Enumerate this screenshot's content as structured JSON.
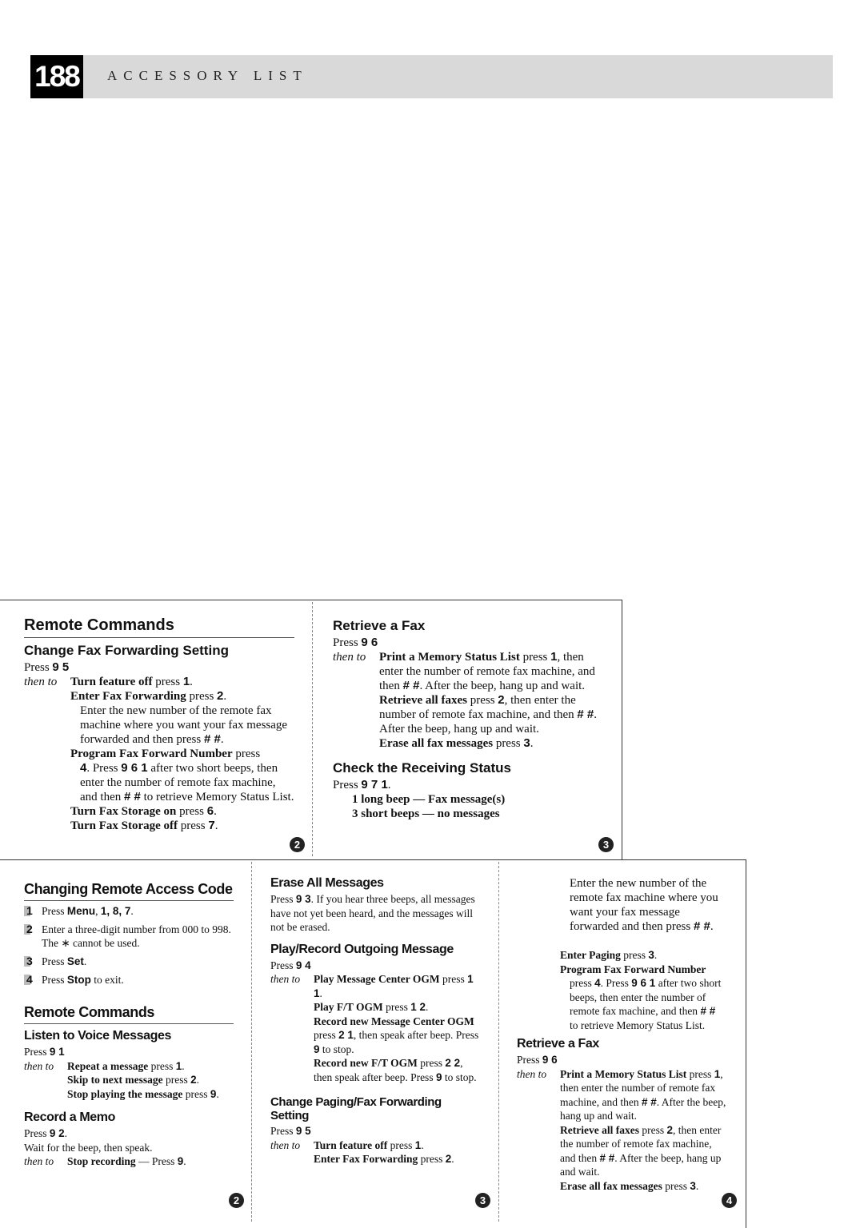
{
  "header": {
    "page_number": "188",
    "title": "ACCESSORY LIST"
  },
  "top_card": {
    "col1": {
      "title": "Remote Commands",
      "section": "Change Fax Forwarding Setting",
      "press_prefix": "Press",
      "press_keys": "9 5",
      "then_to": "then to",
      "items": [
        {
          "bold": "Turn feature off",
          "text": " press ",
          "key": "1",
          "end": "."
        },
        {
          "bold": "Enter Fax Forwarding",
          "text": " press ",
          "key": "2",
          "end": "."
        }
      ],
      "enter_note": {
        "text": "Enter the new number of the remote fax machine where you want your fax message forwarded and then press ",
        "key": "# #",
        "end": "."
      },
      "program": {
        "bold": "Program Fax Forward Number",
        "text": " press",
        "key1": "4",
        "mid1": ". Press ",
        "key2": "9 6 1",
        "mid2": " after two short beeps, then enter the number of remote fax machine, and then ",
        "key3": "# #",
        "end": " to retrieve Memory Status List."
      },
      "storage_on": {
        "bold": "Turn Fax Storage on",
        "text": " press ",
        "key": "6",
        "end": "."
      },
      "storage_off": {
        "bold": "Turn Fax Storage off",
        "text": " press ",
        "key": "7",
        "end": "."
      },
      "badge": "2"
    },
    "col2": {
      "section1": "Retrieve a Fax",
      "press_prefix": "Press",
      "press_keys": "9 6",
      "then_to": "then to",
      "print": {
        "bold": "Print a Memory Status List",
        "text": " press ",
        "key1": "1",
        "mid": ", then enter the number of remote fax machine, and then ",
        "key2": "# #",
        "end": ". After the beep, hang up and wait."
      },
      "retrieve_all": {
        "bold": "Retrieve all faxes",
        "text": " press ",
        "key1": "2",
        "mid": ", then enter the number of remote fax machine, and then ",
        "key2": "# #",
        "end": ". After the beep, hang up and wait."
      },
      "erase": {
        "bold": "Erase all fax messages",
        "text": " press ",
        "key": "3",
        "end": "."
      },
      "section2": "Check the Receiving Status",
      "press2_prefix": "Press",
      "press2_keys": "9 7 1",
      "press2_end": ".",
      "beep1": "1 long beep — Fax message(s)",
      "beep2": "3 short beeps — no messages",
      "badge": "3"
    }
  },
  "bottom_card": {
    "col1": {
      "title": "Changing Remote Access Code",
      "steps": [
        {
          "num": "1",
          "pre": "Press ",
          "key": "Menu",
          "post": ", ",
          "keys2": "1, 8, 7",
          "end": "."
        },
        {
          "num": "2",
          "text": "Enter a three-digit number from 000 to 998. The ∗ cannot be used."
        },
        {
          "num": "3",
          "pre": "Press ",
          "key": "Set",
          "end": "."
        },
        {
          "num": "4",
          "pre": "Press ",
          "key": "Stop",
          "end": " to exit."
        }
      ],
      "title2": "Remote Commands",
      "section1": "Listen to Voice Messages",
      "press1_prefix": "Press",
      "press1_keys": "9 1",
      "then_to": "then to",
      "listen_items": [
        {
          "bold": "Repeat a message",
          "text": " press ",
          "key": "1",
          "end": "."
        },
        {
          "bold": "Skip to next message",
          "text": " press ",
          "key": "2",
          "end": "."
        },
        {
          "bold": "Stop playing the message",
          "text": " press ",
          "key": "9",
          "end": "."
        }
      ],
      "section2": "Record a Memo",
      "press2_prefix": "Press",
      "press2_keys": "9 2",
      "press2_end": ".",
      "memo_note": "Wait for the beep, then speak.",
      "memo_stop": {
        "bold": "Stop recording",
        "text": " — Press ",
        "key": "9",
        "end": "."
      },
      "badge": "2"
    },
    "col2": {
      "section1": "Erase All Messages",
      "erase_pre": "Press ",
      "erase_key": "9 3",
      "erase_text": ". If you hear three beeps, all messages have not yet been heard, and the messages will not be erased.",
      "section2": "Play/Record Outgoing Message",
      "press_prefix": "Press",
      "press_keys": "9 4",
      "then_to": "then to",
      "ogm1": {
        "bold": "Play Message Center OGM",
        "text": " press ",
        "key": "1 1",
        "end": "."
      },
      "ogm2": {
        "bold": "Play F/T OGM",
        "text": " press ",
        "key": "1 2",
        "end": "."
      },
      "ogm3": {
        "bold": "Record new Message Center OGM",
        "text": " press ",
        "key": "2 1",
        "mid": ", then speak after beep. Press ",
        "key2": "9",
        "end": " to stop."
      },
      "ogm4": {
        "bold": "Record new F/T OGM",
        "text": " press ",
        "key": "2 2",
        "mid": ", then speak after beep. Press ",
        "key2": "9",
        "end": " to stop."
      },
      "section3": "Change Paging/Fax Forwarding Setting",
      "press3_prefix": "Press",
      "press3_keys": "9 5",
      "paging_items": [
        {
          "bold": "Turn feature off",
          "text": " press ",
          "key": "1",
          "end": "."
        },
        {
          "bold": "Enter Fax Forwarding",
          "text": " press ",
          "key": "2",
          "end": "."
        }
      ],
      "badge": "3"
    },
    "col3": {
      "enter_note": {
        "text": "Enter the new number of the remote fax machine where you want your fax message forwarded and then press ",
        "key": "# #",
        "end": "."
      },
      "paging": {
        "bold": "Enter Paging",
        "text": " press ",
        "key": "3",
        "end": "."
      },
      "program": {
        "bold": "Program Fax Forward Number",
        "text": " press ",
        "key1": "4",
        "mid1": ". Press ",
        "key2": "9 6 1",
        "mid2": " after two short beeps, then enter the number of remote fax machine, and then ",
        "key3": "# #",
        "end": " to retrieve Memory Status List."
      },
      "section": "Retrieve a Fax",
      "press_prefix": "Press",
      "press_keys": "9 6",
      "then_to": "then to",
      "print": {
        "bold": "Print a Memory Status List",
        "text": " press ",
        "key1": "1",
        "mid": ", then enter the number of remote fax machine, and then ",
        "key2": "# #",
        "end": ". After the beep, hang up and wait."
      },
      "retrieve_all": {
        "bold": "Retrieve all faxes",
        "text": " press ",
        "key1": "2",
        "mid": ", then enter the number of remote fax machine, and then ",
        "key2": "# #",
        "end": ". After the beep, hang up and wait."
      },
      "erase": {
        "bold": "Erase all fax messages",
        "text": " press ",
        "key": "3",
        "end": "."
      },
      "badge": "4"
    }
  }
}
